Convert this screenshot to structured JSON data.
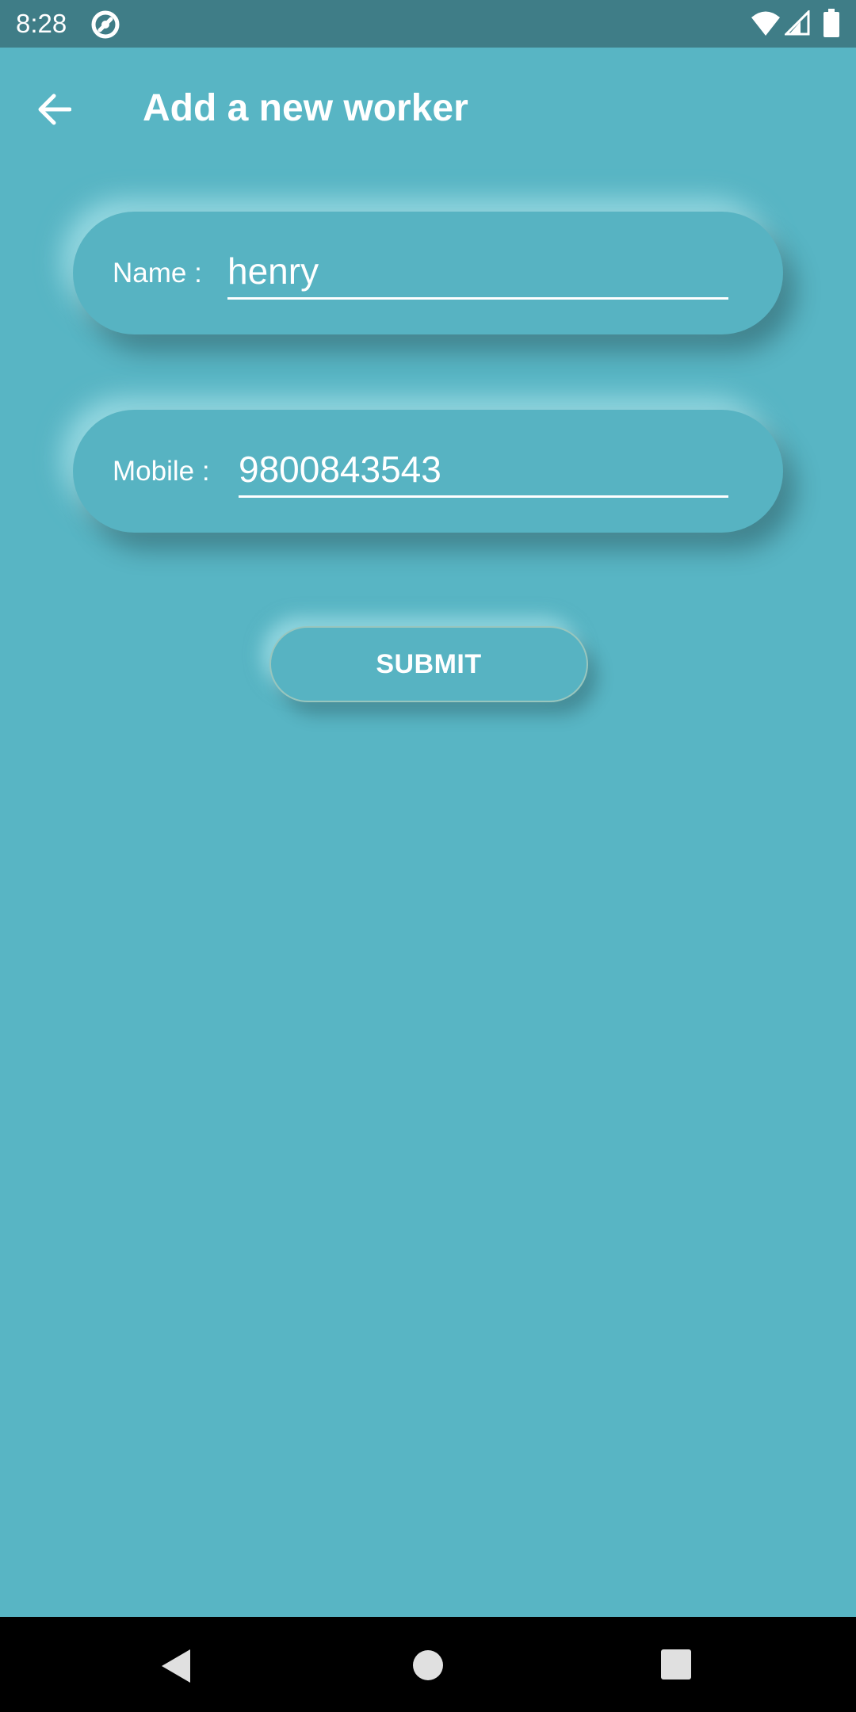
{
  "status_bar": {
    "time": "8:28",
    "icons": [
      "app-notification-icon",
      "wifi-icon",
      "signal-icon",
      "battery-icon"
    ]
  },
  "app_bar": {
    "title": "Add a new worker",
    "back_icon": "arrow-back-icon"
  },
  "form": {
    "name": {
      "label": "Name :",
      "value": "henry"
    },
    "mobile": {
      "label": "Mobile :",
      "value": "9800843543"
    },
    "submit_label": "SUBMIT"
  },
  "nav_bar": {
    "icons": [
      "nav-back-icon",
      "nav-home-icon",
      "nav-recents-icon"
    ]
  },
  "colors": {
    "background": "#58b5c4",
    "status_bar": "#3f7d87",
    "text": "#ffffff",
    "nav_bar": "#000000"
  }
}
